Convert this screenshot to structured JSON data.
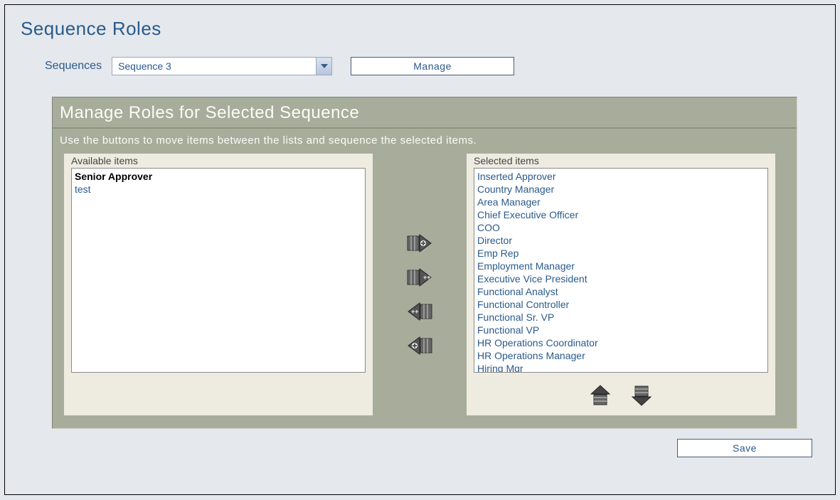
{
  "page_title": "Sequence Roles",
  "toolbar": {
    "label": "Sequences",
    "selected_sequence": "Sequence 3",
    "manage_label": "Manage"
  },
  "roles_panel": {
    "title": "Manage Roles for Selected Sequence",
    "instructions": "Use the buttons to move items between the lists and sequence the selected items.",
    "available_label": "Available items",
    "selected_label": "Selected items",
    "available_items": [
      {
        "label": "Senior Approver",
        "selected": true
      },
      {
        "label": "test",
        "selected": false
      }
    ],
    "selected_items": [
      {
        "label": "Inserted Approver"
      },
      {
        "label": "Country Manager"
      },
      {
        "label": "Area Manager"
      },
      {
        "label": "Chief Executive Officer"
      },
      {
        "label": "COO"
      },
      {
        "label": "Director"
      },
      {
        "label": "Emp Rep"
      },
      {
        "label": "Employment Manager"
      },
      {
        "label": "Executive Vice President"
      },
      {
        "label": "Functional Analyst"
      },
      {
        "label": "Functional Controller"
      },
      {
        "label": "Functional Sr. VP"
      },
      {
        "label": "Functional VP"
      },
      {
        "label": "HR Operations Coordinator"
      },
      {
        "label": "HR Operations Manager"
      },
      {
        "label": "Hiring Mgr"
      }
    ]
  },
  "save_label": "Save"
}
